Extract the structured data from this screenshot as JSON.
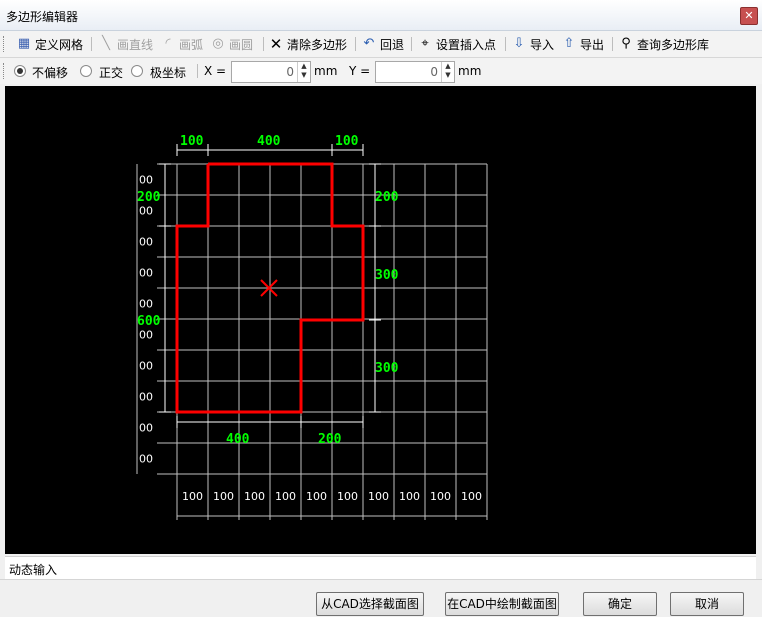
{
  "window": {
    "title": "多边形编辑器",
    "close": "✕"
  },
  "toolbar": {
    "define_grid": "定义网格",
    "draw_line": "画直线",
    "draw_arc": "画弧",
    "draw_circle": "画圆",
    "clear_polygon": "清除多边形",
    "undo": "回退",
    "set_insert_point": "设置插入点",
    "import": "导入",
    "export": "导出",
    "query_library": "查询多边形库"
  },
  "options": {
    "no_offset": "不偏移",
    "orthogonal": "正交",
    "polar": "极坐标",
    "x_label": "X =",
    "y_label": "Y =",
    "x_value": "0",
    "y_value": "0",
    "unit": "mm",
    "selected": "no_offset"
  },
  "drawing": {
    "top_dims": [
      "100",
      "400",
      "100"
    ],
    "bottom_dims": [
      "400",
      "200"
    ],
    "right_dims": [
      "200",
      "300",
      "300"
    ],
    "left_total": "600",
    "left_total_top": "200",
    "left_ticks": [
      "00",
      "00",
      "00",
      "00",
      "00",
      "00",
      "00",
      "00",
      "00",
      "00"
    ],
    "column_labels": [
      "100",
      "100",
      "100",
      "100",
      "100",
      "100",
      "100",
      "100",
      "100",
      "100"
    ],
    "colors": {
      "grid": "#ffffff",
      "polygon": "#ff0000",
      "dims": "#00ff00",
      "text": "#00ff00"
    }
  },
  "tabs": {
    "dynamic_input": "动态输入"
  },
  "footer": {
    "select_from_cad": "从CAD选择截面图",
    "draw_in_cad": "在CAD中绘制截面图",
    "ok": "确定",
    "cancel": "取消"
  }
}
